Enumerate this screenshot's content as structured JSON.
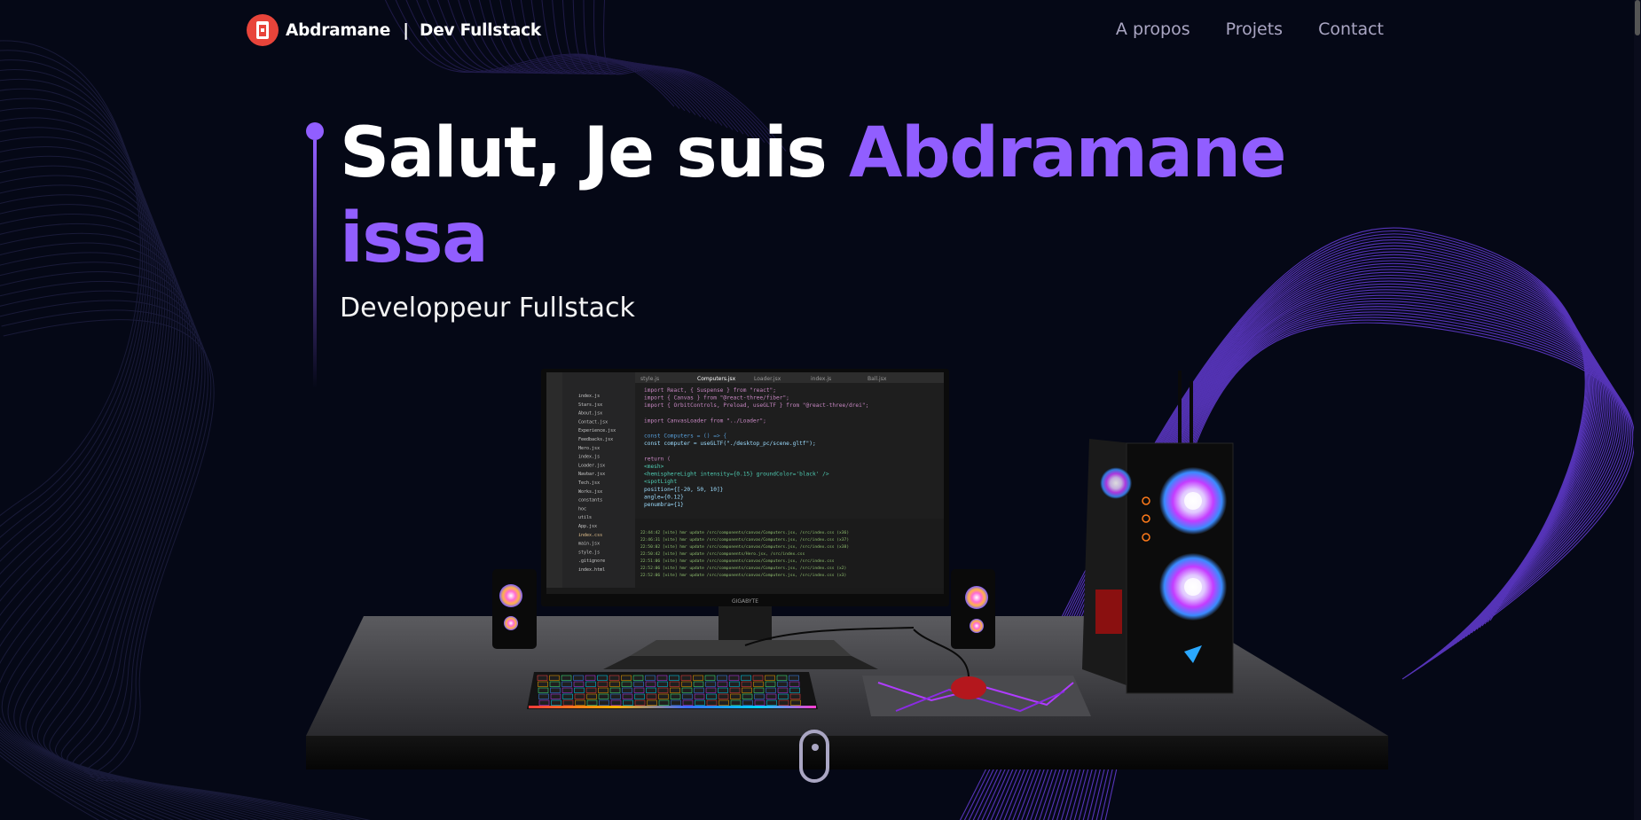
{
  "nav": {
    "logo_icon": "logo-badge-icon",
    "brand_name": "Abdramane",
    "brand_separator": "|",
    "brand_role": "Dev Fullstack",
    "links": [
      {
        "label": "A propos"
      },
      {
        "label": "Projets"
      },
      {
        "label": "Contact"
      }
    ]
  },
  "hero": {
    "greeting": "Salut, Je suis ",
    "name": "Abdramane issa",
    "subtitle": "Developpeur Fullstack"
  },
  "scene": {
    "description_icon": "desktop-computer-3d-icon",
    "monitor_brand": "GIGABYTE",
    "editor_tabs": [
      "style.js",
      "Computers.jsx",
      "Loader.jsx",
      "index.js",
      "Ball.jsx"
    ],
    "code_lines": [
      "import React, { Suspense } from \"react\";",
      "import { Canvas } from \"@react-three/fiber\";",
      "import { OrbitControls, Preload, useGLTF } from \"@react-three/drei\";",
      "",
      "import CanvasLoader from \"../Loader\";",
      "",
      "const Computers = () => {",
      "  const computer = useGLTF(\"./desktop_pc/scene.gltf\");",
      "",
      "  return (",
      "    <mesh>",
      "      <hemisphereLight intensity={0.15} groundColor='black' />",
      "      <spotLight",
      "        position={[-20, 50, 10]}",
      "        angle={0.12}",
      "        penumbra={1}"
    ],
    "explorer_files": [
      "index.js",
      "Stars.jsx",
      "About.jsx",
      "Contact.jsx",
      "Experience.jsx",
      "Feedbacks.jsx",
      "Hero.jsx",
      "index.js",
      "Loader.jsx",
      "Navbar.jsx",
      "Tech.jsx",
      "Works.jsx",
      "constants",
      "hoc",
      "utils",
      "App.jsx",
      "index.css",
      "main.jsx",
      "style.js",
      ".gitignore",
      "index.html"
    ],
    "terminal_lines": [
      "22:44:42 [vite] hmr update /src/components/canvas/Computers.jsx, /src/index.css (x36)",
      "22:46:31 [vite] hmr update /src/components/canvas/Computers.jsx, /src/index.css (x37)",
      "22:50:02 [vite] hmr update /src/components/canvas/Computers.jsx, /src/index.css (x38)",
      "22:50:42 [vite] hmr update /src/components/Hero.jsx, /src/index.css",
      "22:51:06 [vite] hmr update /src/components/canvas/Computers.jsx, /src/index.css",
      "22:52:06 [vite] hmr update /src/components/canvas/Computers.jsx, /src/index.css (x2)",
      "22:52:06 [vite] hmr update /src/components/canvas/Computers.jsx, /src/index.css (x3)"
    ]
  },
  "scroll_indicator_icon": "mouse-scroll-icon",
  "colors": {
    "background": "#050816",
    "accent": "#915eff",
    "nav_text": "#aaa6c3",
    "logo_red": "#e8443a"
  }
}
